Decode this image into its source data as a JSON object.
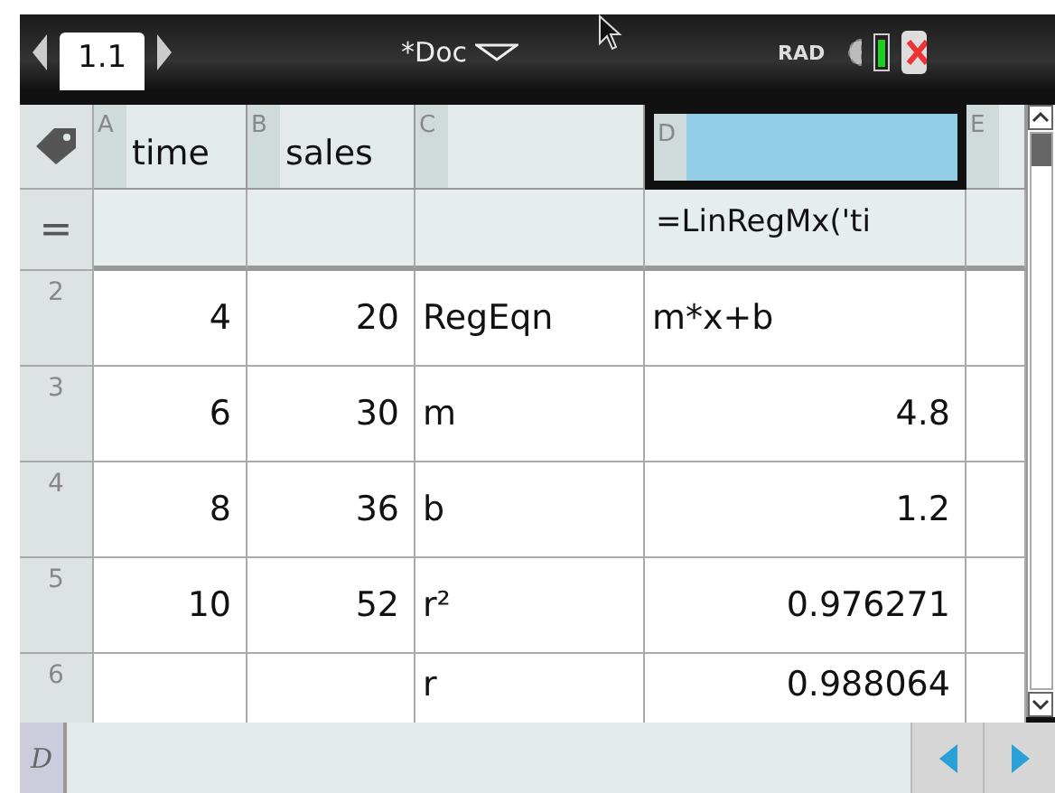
{
  "toolbar": {
    "tabs": [
      {
        "label": "1.1",
        "selected": true
      }
    ],
    "title": "*Doc",
    "mode": "RAD"
  },
  "columns": [
    {
      "letter": "A",
      "name": "time",
      "selected": false
    },
    {
      "letter": "B",
      "name": "sales",
      "selected": false
    },
    {
      "letter": "C",
      "selected": false
    },
    {
      "letter": "D",
      "selected": true
    },
    {
      "letter": "E",
      "selected": false
    }
  ],
  "formula_row": {
    "symbol": "=",
    "cells": [
      null,
      null,
      null,
      "=LinRegMx('ti",
      null
    ]
  },
  "rows": [
    {
      "label": "2",
      "cells": [
        {
          "value": "4",
          "kind": "number"
        },
        {
          "value": "20",
          "kind": "number"
        },
        {
          "value": "RegEqn",
          "kind": "text"
        },
        {
          "value": "m*x+b",
          "kind": "text"
        },
        null
      ]
    },
    {
      "label": "3",
      "cells": [
        {
          "value": "6",
          "kind": "number"
        },
        {
          "value": "30",
          "kind": "number"
        },
        {
          "value": "m",
          "kind": "text"
        },
        {
          "value": "4.8",
          "kind": "number"
        },
        null
      ]
    },
    {
      "label": "4",
      "cells": [
        {
          "value": "8",
          "kind": "number"
        },
        {
          "value": "36",
          "kind": "number"
        },
        {
          "value": "b",
          "kind": "text"
        },
        {
          "value": "1.2",
          "kind": "number"
        },
        null
      ]
    },
    {
      "label": "5",
      "cells": [
        {
          "value": "10",
          "kind": "number"
        },
        {
          "value": "52",
          "kind": "number"
        },
        {
          "value": "r²",
          "kind": "text"
        },
        {
          "value": "0.976271",
          "kind": "number"
        },
        null
      ]
    },
    {
      "label": "6",
      "cells": [
        null,
        null,
        {
          "value": "r",
          "kind": "text"
        },
        {
          "value": "0.988064",
          "kind": "number"
        },
        null
      ]
    }
  ],
  "entry_line": {
    "label": "D"
  }
}
